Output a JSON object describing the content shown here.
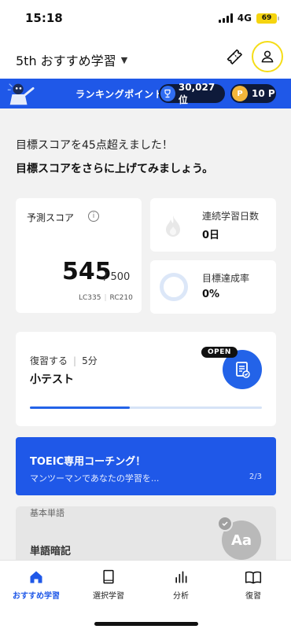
{
  "status": {
    "time": "15:18",
    "network": "4G",
    "battery": "69"
  },
  "header": {
    "course_title": "5th おすすめ学習",
    "caret_icon": "chevron-down-icon",
    "ticket_icon": "ticket-icon",
    "profile_icon": "user-icon",
    "profile_highlight": "#f5dd18"
  },
  "ranking": {
    "label": "ランキングポイント",
    "rank": "30,027 位",
    "points": "10 P",
    "coin_glyph": "P",
    "bg_color": "#1f58e8"
  },
  "messages": {
    "line1": "目標スコアを45点超えました！",
    "line2": "目標スコアをさらに上げてみましょう。"
  },
  "score": {
    "label": "予測スコア",
    "info_glyph": "i",
    "value": "545",
    "max": "/ 500",
    "lc": "LC335",
    "rc": "RC210"
  },
  "streak": {
    "label": "連続学習日数",
    "value": "0日"
  },
  "goal": {
    "label": "目標達成率",
    "value": "0%"
  },
  "review": {
    "label": "復習する",
    "duration": "5分",
    "title": "小テスト",
    "badge": "OPEN",
    "progress_fraction": 0.43,
    "accent": "#2363e8"
  },
  "coaching": {
    "title": "TOEIC専用コーチング！",
    "subtitle": "マンツーマンであなたの学習を...",
    "pager": "2/3"
  },
  "vocab": {
    "subtitle": "基本単語",
    "title": "単語暗記",
    "icon_text": "Aa"
  },
  "tabs": [
    {
      "label": "おすすめ学習",
      "icon": "home-icon",
      "active": true
    },
    {
      "label": "選択学習",
      "icon": "book-icon",
      "active": false
    },
    {
      "label": "分析",
      "icon": "bar-chart-icon",
      "active": false
    },
    {
      "label": "復習",
      "icon": "open-book-icon",
      "active": false
    }
  ]
}
